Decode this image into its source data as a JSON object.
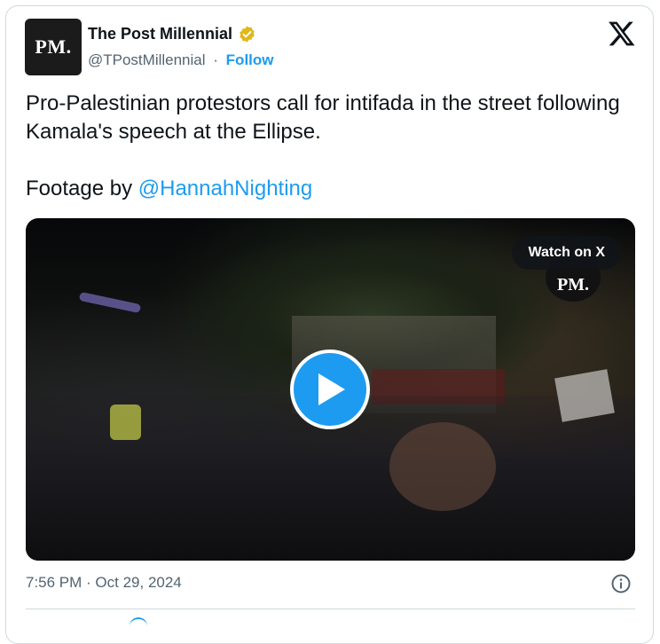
{
  "account": {
    "avatar_text": "PM.",
    "name": "The Post Millennial",
    "handle": "@TPostMillennial",
    "separator": "·",
    "follow_label": "Follow",
    "verified_badge_color": "#e2b719"
  },
  "platform_icon": "x-logo-icon",
  "tweet": {
    "line1": "Pro-Palestinian protestors call for intifada in the street following Kamala's speech at the Ellipse.",
    "footage_prefix": "Footage by ",
    "mention": "@HannahNighting"
  },
  "video": {
    "watch_label": "Watch on X",
    "watermark": "PM.",
    "play_icon": "play-icon"
  },
  "meta": {
    "timestamp": "7:56 PM · Oct 29, 2024",
    "info_icon": "info-icon"
  },
  "colors": {
    "link": "#1d9bf0",
    "text": "#0f1419",
    "muted": "#536471",
    "border": "#cfd9de"
  }
}
